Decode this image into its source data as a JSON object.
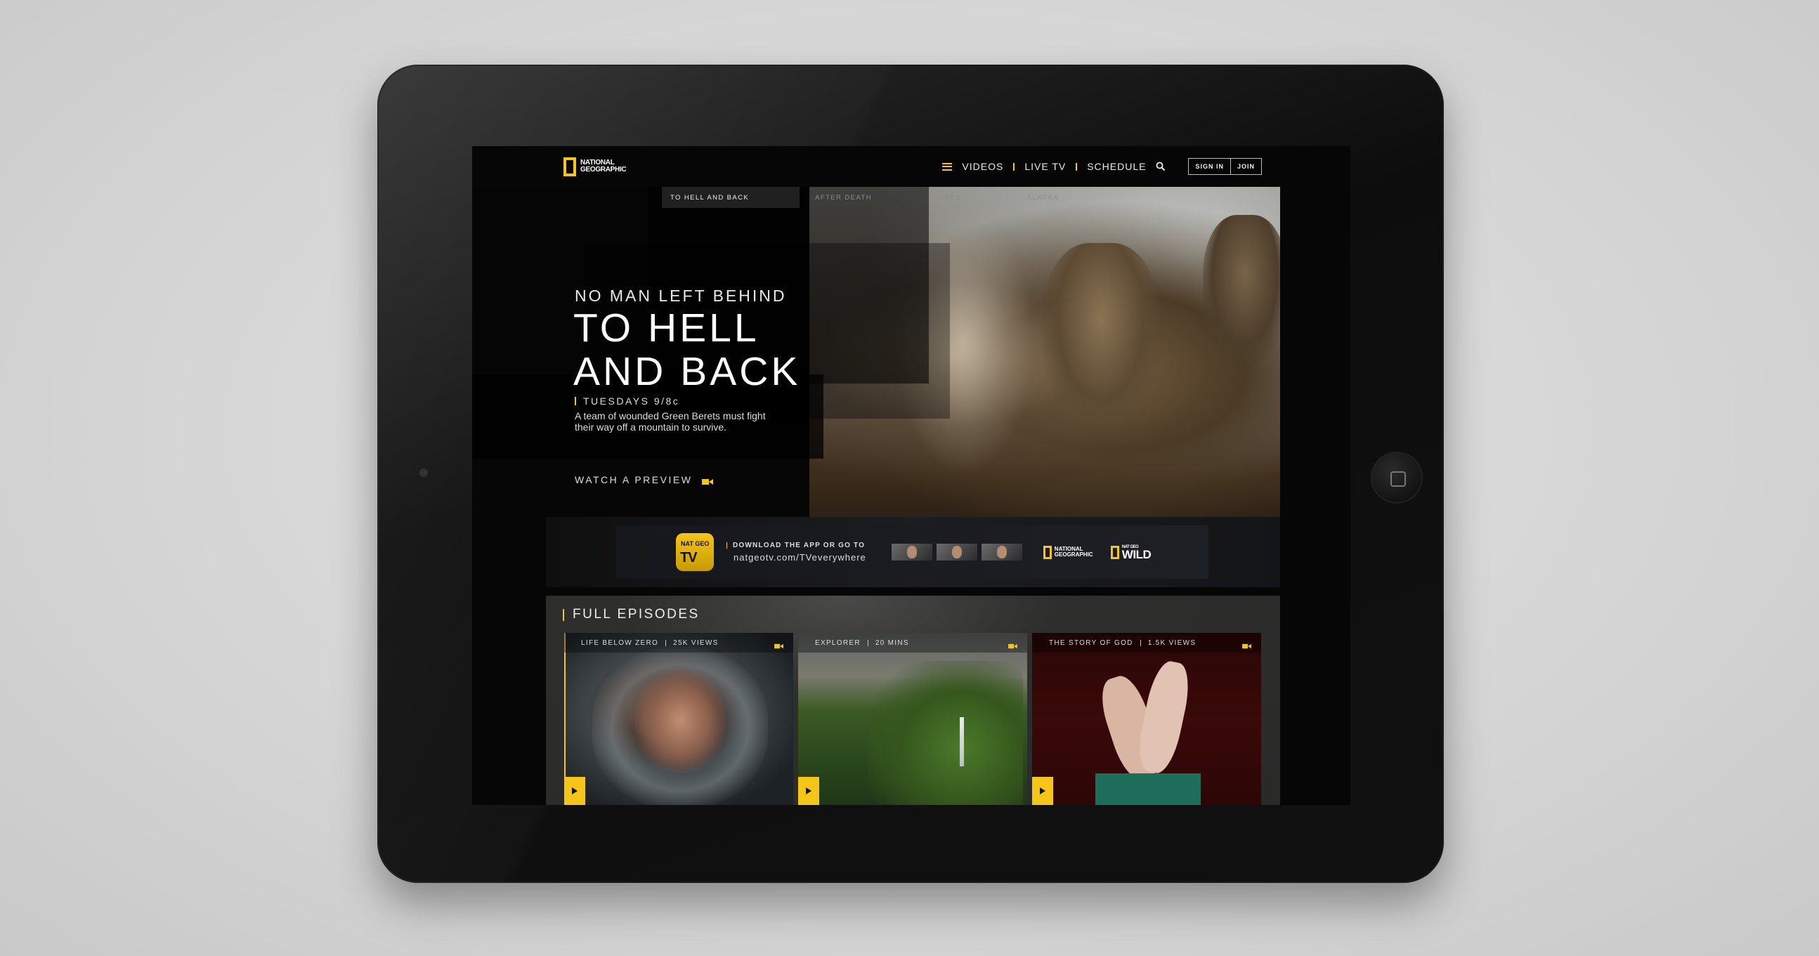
{
  "brand": {
    "logo_text": "NATIONAL GEOGRAPHIC",
    "accent": "#f5c518"
  },
  "nav": {
    "items": [
      "VIDEOS",
      "LIVE TV",
      "SCHEDULE"
    ],
    "sign_in": "SIGN IN",
    "join": "JOIN"
  },
  "hero": {
    "tabs": [
      "TO HELL AND BACK",
      "AFTER DEATH",
      "MARS",
      "ALASKA"
    ],
    "active_tab": "TO HELL AND BACK",
    "kicker": "NO MAN LEFT BEHIND",
    "title_line1": "TO HELL",
    "title_line2": "AND BACK",
    "airing": "TUESDAYS 9/8c",
    "description": "A team of wounded Green Berets must fight their way off a mountain to survive.",
    "cta": "WATCH A PREVIEW"
  },
  "app_banner": {
    "icon_small": "NAT GEO",
    "icon_big": "TV",
    "line1": "DOWNLOAD THE APP OR GO TO",
    "line2": "natgeotv.com/TVeverywhere",
    "brand1": "NATIONAL GEOGRAPHIC",
    "brand2_small": "NAT GEO",
    "brand2_big": "WILD"
  },
  "episodes": {
    "heading": "FULL EPISODES",
    "cards": [
      {
        "show": "LIFE BELOW ZERO",
        "meta": "25K VIEWS"
      },
      {
        "show": "EXPLORER",
        "meta": "20 MINS"
      },
      {
        "show": "THE STORY OF GOD",
        "meta": "1.5K VIEWS"
      }
    ]
  }
}
